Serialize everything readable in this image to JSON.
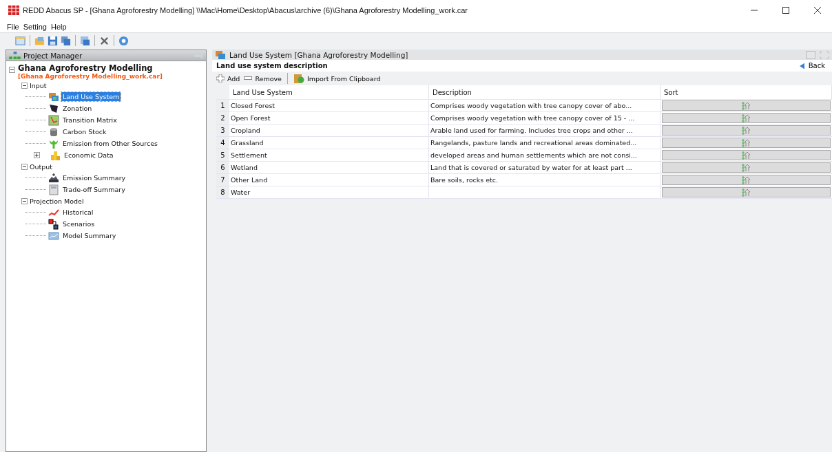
{
  "window": {
    "title": "REDD Abacus SP - [Ghana Agroforestry Modelling] \\\\Mac\\Home\\Desktop\\Abacus\\archive (6)\\Ghana Agroforestry  Modelling_work.car"
  },
  "menu": [
    "File",
    "Setting",
    "Help"
  ],
  "project_manager": {
    "title": "Project Manager",
    "project": "Ghana Agroforestry Modelling",
    "file": "[Ghana Agroforestry Modelling_work.car]",
    "tree": [
      {
        "label": "Input",
        "expanded": true,
        "children": [
          {
            "label": "Land Use System",
            "selected": true
          },
          {
            "label": "Zonation",
            "selected": false
          },
          {
            "label": "Transition Matrix",
            "selected": false
          },
          {
            "label": "Carbon Stock",
            "selected": false
          },
          {
            "label": "Emission from Other Sources",
            "selected": false
          },
          {
            "label": "Economic Data",
            "selected": false,
            "expanded": false
          }
        ]
      },
      {
        "label": "Output",
        "expanded": true,
        "children": [
          {
            "label": "Emission Summary",
            "selected": false
          },
          {
            "label": "Trade-off Summary",
            "selected": false
          }
        ]
      },
      {
        "label": "Projection Model",
        "expanded": true,
        "children": [
          {
            "label": "Historical",
            "selected": false
          },
          {
            "label": "Scenarios",
            "selected": false
          },
          {
            "label": "Model Summary",
            "selected": false
          }
        ]
      }
    ]
  },
  "editor": {
    "title": "Land Use System [Ghana Agroforestry Modelling]",
    "heading": "Land use system description",
    "back": "Back",
    "actions": [
      "Add",
      "Remove",
      "Import From Clipboard"
    ],
    "table": {
      "columns": [
        "Land Use System",
        "Description",
        "Sort"
      ],
      "rows": [
        {
          "number": "1",
          "name": "Closed Forest",
          "description": "Comprises woody vegetation with tree canopy cover of abo..."
        },
        {
          "number": "2",
          "name": "Open Forest",
          "description": "Comprises woody vegetation with tree canopy cover of 15 - ..."
        },
        {
          "number": "3",
          "name": "Cropland",
          "description": "Arable land used for farming. Includes tree crops and other ..."
        },
        {
          "number": "4",
          "name": "Grassland",
          "description": "Rangelands, pasture lands and recreational areas dominated..."
        },
        {
          "number": "5",
          "name": "Settlement",
          "description": "developed areas and human settlements which are not consi..."
        },
        {
          "number": "6",
          "name": "Wetland",
          "description": "Land that is covered or saturated by water for at least part ..."
        },
        {
          "number": "7",
          "name": "Other Land",
          "description": "Bare soils, rocks etc."
        },
        {
          "number": "8",
          "name": "Water",
          "description": ""
        }
      ]
    }
  }
}
